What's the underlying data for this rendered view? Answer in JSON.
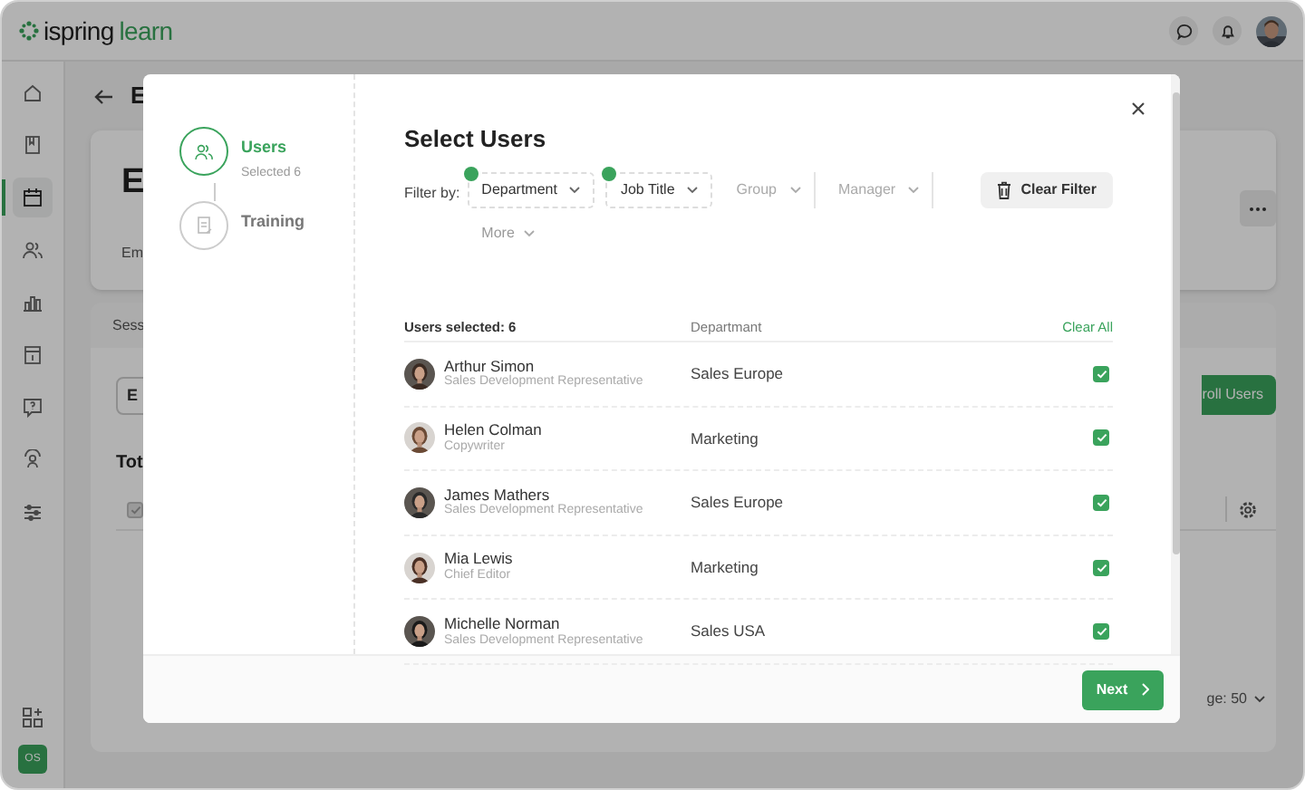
{
  "brand": {
    "name": "ispring",
    "product": "learn"
  },
  "sidebar": {
    "items": [
      {
        "selected": false
      },
      {
        "selected": false
      },
      {
        "selected": true
      },
      {
        "selected": false
      },
      {
        "selected": false
      },
      {
        "selected": false
      },
      {
        "selected": false
      },
      {
        "selected": false
      },
      {
        "selected": false
      }
    ],
    "user_badge": "OS"
  },
  "page": {
    "title": "E",
    "card_title": "E",
    "card_label": "Em",
    "tab": "Sess",
    "toolbar_button": "E",
    "enroll_button": "roll Users",
    "total_label": "Tot",
    "select_all_checked": true,
    "per_page": "ge: 50"
  },
  "modal": {
    "steps": [
      {
        "label": "Users",
        "sublabel": "Selected 6",
        "selected": true
      },
      {
        "label": "Training",
        "selected": false
      }
    ],
    "title": "Select Users",
    "filter_label": "Filter by:",
    "filters": [
      {
        "label": "Department",
        "active": true
      },
      {
        "label": "Job Title",
        "active": true
      },
      {
        "label": "Group",
        "active": false
      },
      {
        "label": "Manager",
        "active": false
      }
    ],
    "more": "More",
    "clear_filter": "Clear Filter",
    "table": {
      "columns": [
        "Users selected: 6",
        "Departmant"
      ],
      "clear_all": "Clear All",
      "rows": [
        {
          "name": "Arthur Simon",
          "title": "Sales Development Representative",
          "department": "Sales Europe",
          "checked": true
        },
        {
          "name": "Helen Colman",
          "title": "Copywriter",
          "department": "Marketing",
          "checked": true
        },
        {
          "name": "James Mathers",
          "title": "Sales Development Representative",
          "department": "Sales Europe",
          "checked": true
        },
        {
          "name": "Mia Lewis",
          "title": "Chief Editor",
          "department": "Marketing",
          "checked": true
        },
        {
          "name": "Michelle Norman",
          "title": "Sales Development Representative",
          "department": "Sales USA",
          "checked": true
        }
      ]
    },
    "next": "Next"
  }
}
